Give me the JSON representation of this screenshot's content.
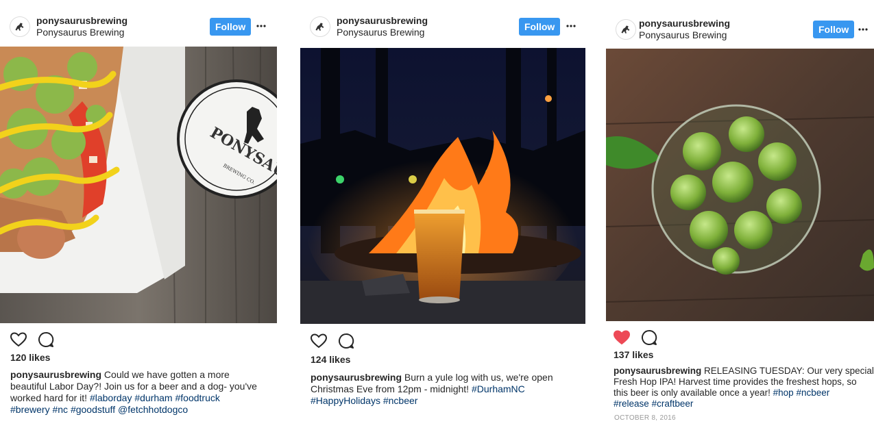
{
  "posts": [
    {
      "username": "ponysaurusbrewing",
      "fullname": "Ponysaurus Brewing",
      "follow_label": "Follow",
      "more_icon": "more-horizontal-icon",
      "photo_description_icon": "hotdog-and-coaster-photo",
      "coaster_text": "PONYSAURUS",
      "coaster_subtext": "BREWING CO.",
      "liked": false,
      "likes": "120 likes",
      "caption_user": "ponysaurusbrewing",
      "caption_lines": [
        "Could we have gotten a more",
        "beautiful Labor Day?! Join us for a beer and a dog- you've",
        "worked hard for it!"
      ],
      "tags_line3": [
        "#laborday",
        "#durham",
        "#foodtruck"
      ],
      "tags_line4": [
        "#brewery",
        "#nc",
        "#goodstuff",
        "@fetchhotdogco"
      ]
    },
    {
      "username": "ponysaurusbrewing",
      "fullname": "Ponysaurus Brewing",
      "follow_label": "Follow",
      "more_icon": "more-horizontal-icon",
      "photo_description_icon": "campfire-beer-photo",
      "liked": false,
      "likes": "124 likes",
      "caption_user": "ponysaurusbrewing",
      "caption_lines": [
        "Burn a yule log with us, we're open",
        "Christmas Eve from 12pm - midnight!"
      ],
      "tags_line2": [
        "#DurhamNC"
      ],
      "tags_line3": [
        "#HappyHolidays",
        "#ncbeer"
      ]
    },
    {
      "username": "ponysaurusbrewing",
      "fullname": "Ponysaurus Brewing",
      "follow_label": "Follow",
      "more_icon": "more-horizontal-icon",
      "photo_description_icon": "hops-in-glass-photo",
      "liked": true,
      "likes": "137 likes",
      "caption_user": "ponysaurusbrewing",
      "caption_lines": [
        "RELEASING TUESDAY: Our very special",
        "Fresh Hop IPA! Harvest time provides the freshest hops, so",
        "this beer is only available once a year!"
      ],
      "tags_line3": [
        "#hop",
        "#ncbeer"
      ],
      "tags_line4": [
        "#release",
        "#craftbeer"
      ],
      "date": "OCTOBER 8, 2016"
    }
  ],
  "colors": {
    "follow_button": "#3897f0",
    "hashtag": "#003569",
    "liked_heart": "#ed4956",
    "text": "#262626",
    "muted": "#999999"
  }
}
